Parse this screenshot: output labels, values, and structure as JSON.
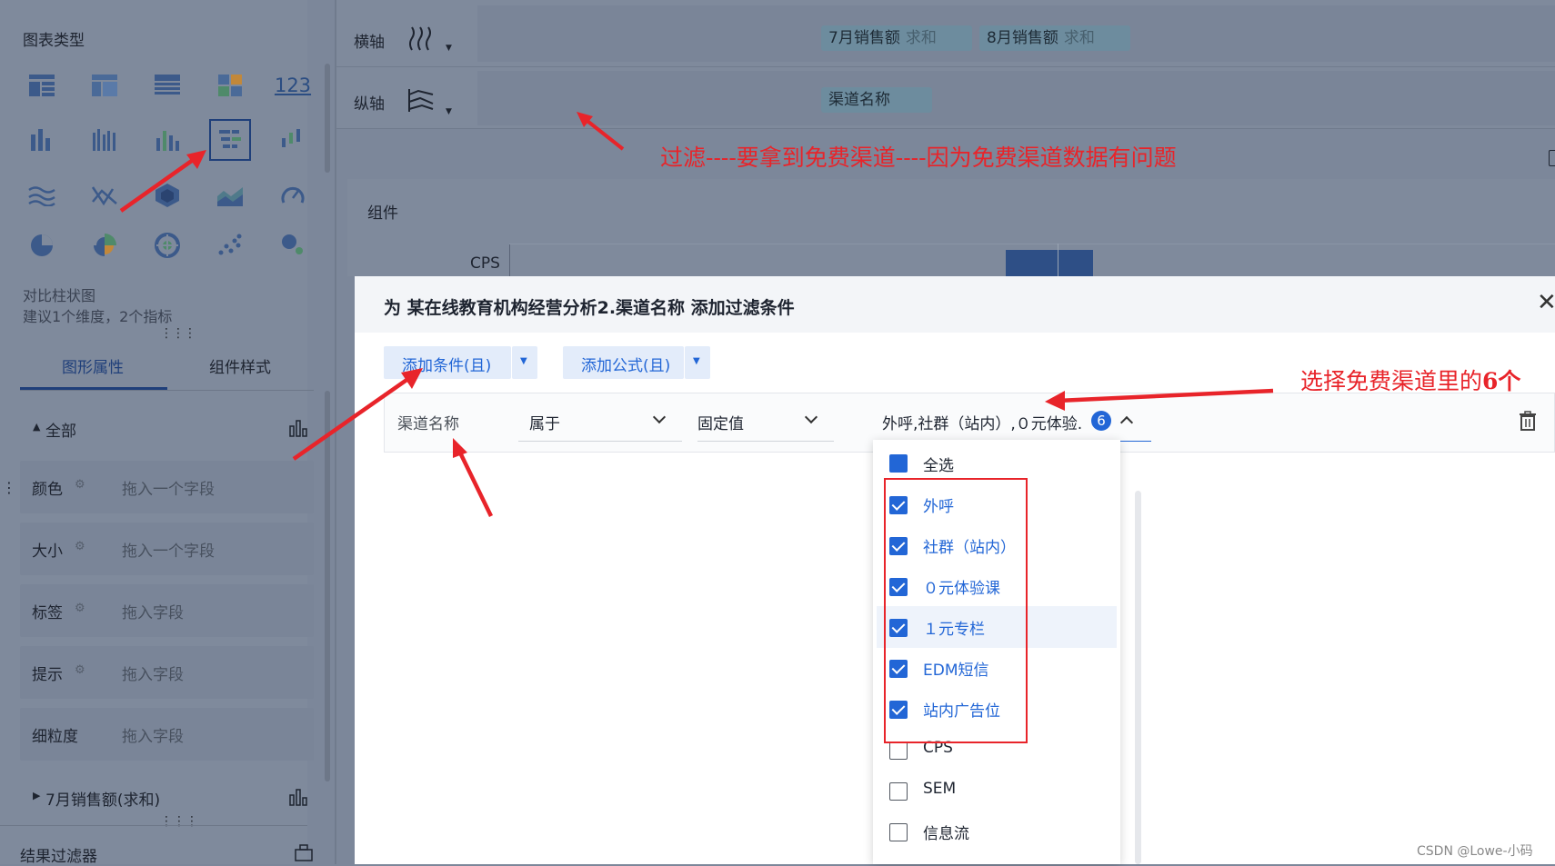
{
  "left": {
    "title": "图表类型",
    "chart_name": "对比柱状图",
    "chart_hint": "建议1个维度，2个指标",
    "tabs": [
      "图形属性",
      "组件样式"
    ],
    "all_section": "全部",
    "fields": [
      {
        "label": "颜色",
        "placeholder": "拖入一个字段"
      },
      {
        "label": "大小",
        "placeholder": "拖入一个字段"
      },
      {
        "label": "标签",
        "placeholder": "拖入字段"
      },
      {
        "label": "提示",
        "placeholder": "拖入字段"
      },
      {
        "label": "细粒度",
        "placeholder": "拖入字段"
      }
    ],
    "series_section": "7月销售额(求和)",
    "result_filter": "结果过滤器"
  },
  "axes": {
    "x_label": "横轴",
    "y_label": "纵轴",
    "x_pills": [
      {
        "name": "7月销售额",
        "agg": "求和"
      },
      {
        "name": "8月销售额",
        "agg": "求和"
      }
    ],
    "y_pill": "渠道名称"
  },
  "canvas": {
    "component_label": "组件",
    "cps_label": "CPS"
  },
  "annotations": {
    "filter_note": "过滤----要拿到免费渠道----因为免费渠道数据有问题",
    "select_note_prefix": "选择免费渠道里的",
    "select_note_count": "6个"
  },
  "dialog": {
    "title": "为 某在线教育机构经营分析2.渠道名称 添加过滤条件",
    "close_icon": "close-icon",
    "add_condition": "添加条件(且)",
    "add_formula": "添加公式(且)",
    "field": "渠道名称",
    "operator": "属于",
    "value_type": "固定值",
    "selected_summary": "外呼,社群（站内）,０元体验.",
    "selected_count": "6",
    "select_all": "全选",
    "options": [
      {
        "label": "外呼",
        "checked": true
      },
      {
        "label": "社群（站内）",
        "checked": true
      },
      {
        "label": "０元体验课",
        "checked": true
      },
      {
        "label": "１元专栏",
        "checked": true
      },
      {
        "label": "EDM短信",
        "checked": true
      },
      {
        "label": "站内广告位",
        "checked": true
      },
      {
        "label": "CPS",
        "checked": false
      },
      {
        "label": "SEM",
        "checked": false
      },
      {
        "label": "信息流",
        "checked": false
      }
    ]
  },
  "watermark": "CSDN @Lowe-小码",
  "colors": {
    "accent": "#2266d6",
    "annotation": "#e8242a",
    "overlay": "#7c879a"
  }
}
